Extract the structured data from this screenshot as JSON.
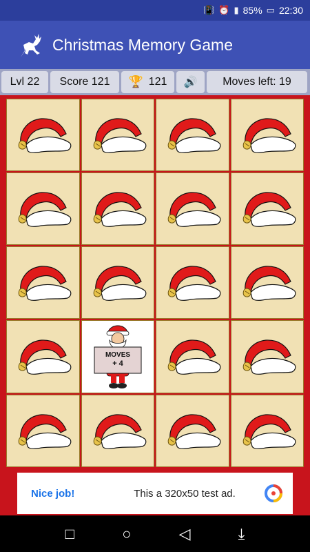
{
  "status": {
    "battery": "85%",
    "time": "22:30",
    "icons": [
      "vibrate-icon",
      "alarm-icon",
      "signal-icon",
      "battery-icon"
    ]
  },
  "app": {
    "title": "Christmas Memory Game",
    "logo": "reindeer-icon"
  },
  "hud": {
    "level": "Lvl 22",
    "score": "Score 121",
    "best": "121",
    "best_icon": "trophy-icon",
    "sound_icon": "speaker-icon",
    "moves": "Moves left: 19"
  },
  "board": {
    "rows": 5,
    "cols": 4,
    "face_down_icon": "santa-hat-icon",
    "revealed": {
      "row": 4,
      "col": 2,
      "icon": "santa-icon",
      "line1": "MOVES",
      "line2": "+ 4"
    }
  },
  "ad": {
    "label": "Nice job!",
    "text": "This a 320x50 test ad.",
    "icon": "ad-logo-icon"
  },
  "nav": {
    "icons": [
      "square-icon",
      "circle-icon",
      "back-triangle-icon",
      "notification-icon"
    ],
    "glyphs": [
      "□",
      "○",
      "◁",
      "⤓"
    ]
  }
}
